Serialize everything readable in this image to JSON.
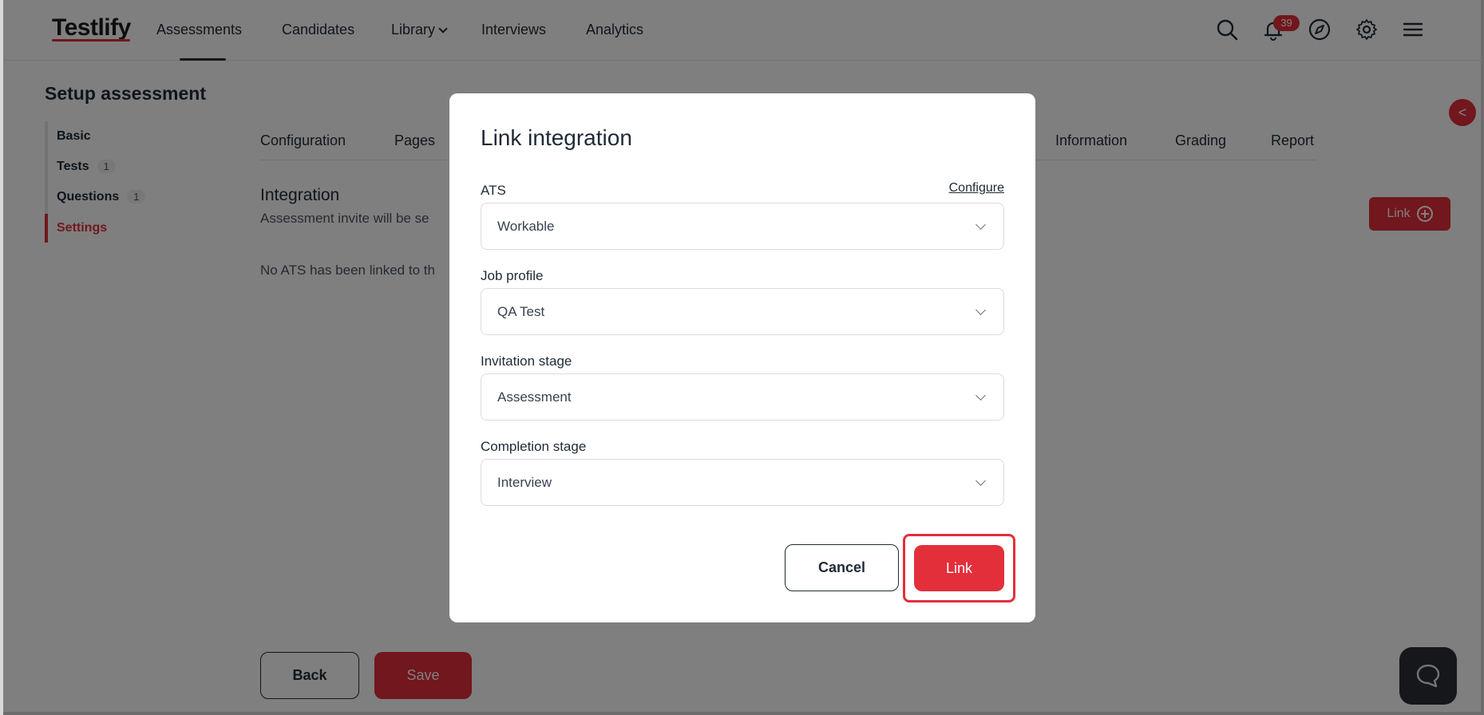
{
  "brand": {
    "logo_text": "Testlify"
  },
  "nav": {
    "items": [
      {
        "label": "Assessments"
      },
      {
        "label": "Candidates"
      },
      {
        "label": "Library"
      },
      {
        "label": "Interviews"
      },
      {
        "label": "Analytics"
      }
    ],
    "notifications_count": "39",
    "icons": [
      "search-icon",
      "bell-icon",
      "compass-icon",
      "gear-icon",
      "menu-icon"
    ]
  },
  "page": {
    "title": "Setup assessment",
    "sidebar": [
      {
        "label": "Basic",
        "count": ""
      },
      {
        "label": "Tests",
        "count": "1"
      },
      {
        "label": "Questions",
        "count": "1"
      },
      {
        "label": "Settings",
        "count": ""
      }
    ],
    "tabs": [
      {
        "label": "Configuration"
      },
      {
        "label": "Pages"
      },
      {
        "label": "Information"
      },
      {
        "label": "Grading"
      },
      {
        "label": "Report"
      }
    ],
    "section_title": "Integration",
    "section_desc": "Assessment invite will be se",
    "empty_message": "No ATS has been linked to th",
    "link_button": "Link",
    "collapse_symbol": "<",
    "back_button": "Back",
    "save_button": "Save"
  },
  "modal": {
    "title": "Link integration",
    "configure_link": "Configure",
    "fields": [
      {
        "label": "ATS",
        "value": "Workable"
      },
      {
        "label": "Job profile",
        "value": "QA Test"
      },
      {
        "label": "Invitation stage",
        "value": "Assessment"
      },
      {
        "label": "Completion stage",
        "value": "Interview"
      }
    ],
    "cancel_button": "Cancel",
    "link_button": "Link"
  },
  "colors": {
    "accent": "#e32f3a",
    "text": "#1f2a37",
    "overlay": "rgba(0,0,0,0.5)"
  }
}
